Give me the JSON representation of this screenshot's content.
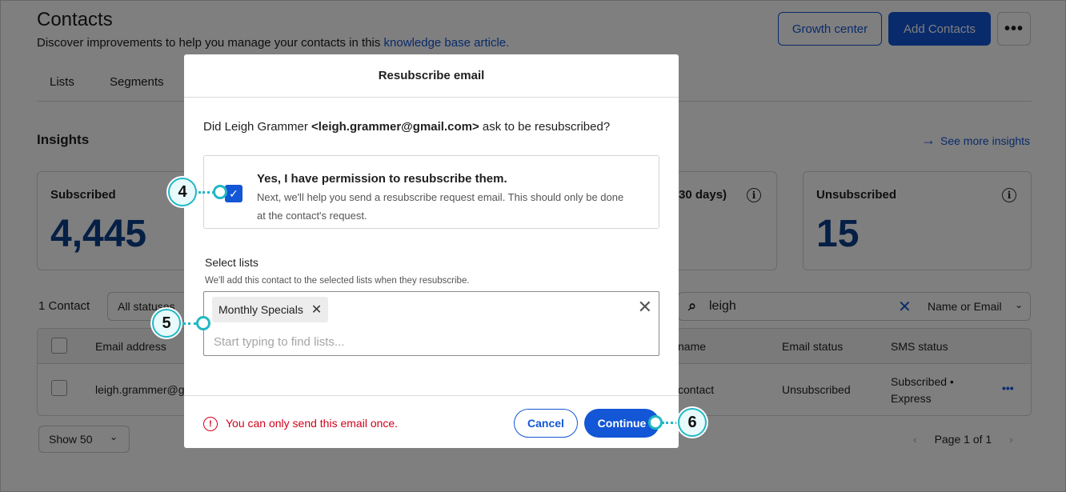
{
  "header": {
    "title": "Contacts",
    "subtitle": "Discover improvements to help you manage your contacts in this ",
    "subtitle_link": "knowledge base article.",
    "growth_center": "Growth center",
    "add_contacts": "Add Contacts",
    "more": "•••"
  },
  "tabs": [
    {
      "label": "Lists"
    },
    {
      "label": "Segments"
    }
  ],
  "insights": {
    "title": "Insights",
    "see_more": "See more insights",
    "cards": [
      {
        "label": "Subscribed",
        "value": "4,445"
      },
      {
        "label": "30 days)"
      },
      {
        "label": "Unsubscribed",
        "value": "15"
      }
    ]
  },
  "toolbar": {
    "count": "1 Contact",
    "status_filter": "All statuses",
    "search_value": "leigh",
    "search_scope": "Name or Email"
  },
  "table": {
    "headers": [
      "Email address",
      "name",
      "Email status",
      "SMS status"
    ],
    "rows": [
      {
        "email": "leigh.grammer@g",
        "name": "contact",
        "email_status": "Unsubscribed",
        "sms_status_line1": "Subscribed •",
        "sms_status_line2": "Express",
        "more": "•••"
      }
    ]
  },
  "pagination": {
    "show": "Show 50",
    "page": "Page 1 of 1"
  },
  "modal": {
    "title": "Resubscribe email",
    "question_prefix": "Did Leigh Grammer ",
    "question_email": "<leigh.grammer@gmail.com>",
    "question_suffix": " ask to be resubscribed?",
    "permission_title": "Yes, I have permission to resubscribe them.",
    "permission_desc": "Next, we'll help you send a resubscribe request email. This should only be done at the contact's request.",
    "select_label": "Select lists",
    "select_hint": "We'll add this contact to the selected lists when they resubscribe.",
    "selected_chip": "Monthly Specials",
    "select_placeholder": "Start typing to find lists...",
    "error": "You can only send this email once.",
    "cancel": "Cancel",
    "continue": "Continue"
  },
  "callouts": [
    "4",
    "5",
    "6"
  ],
  "colors": {
    "accent": "#1356d6",
    "number": "#0b3e8a",
    "error": "#d0021b",
    "callout": "#22b7c4"
  }
}
